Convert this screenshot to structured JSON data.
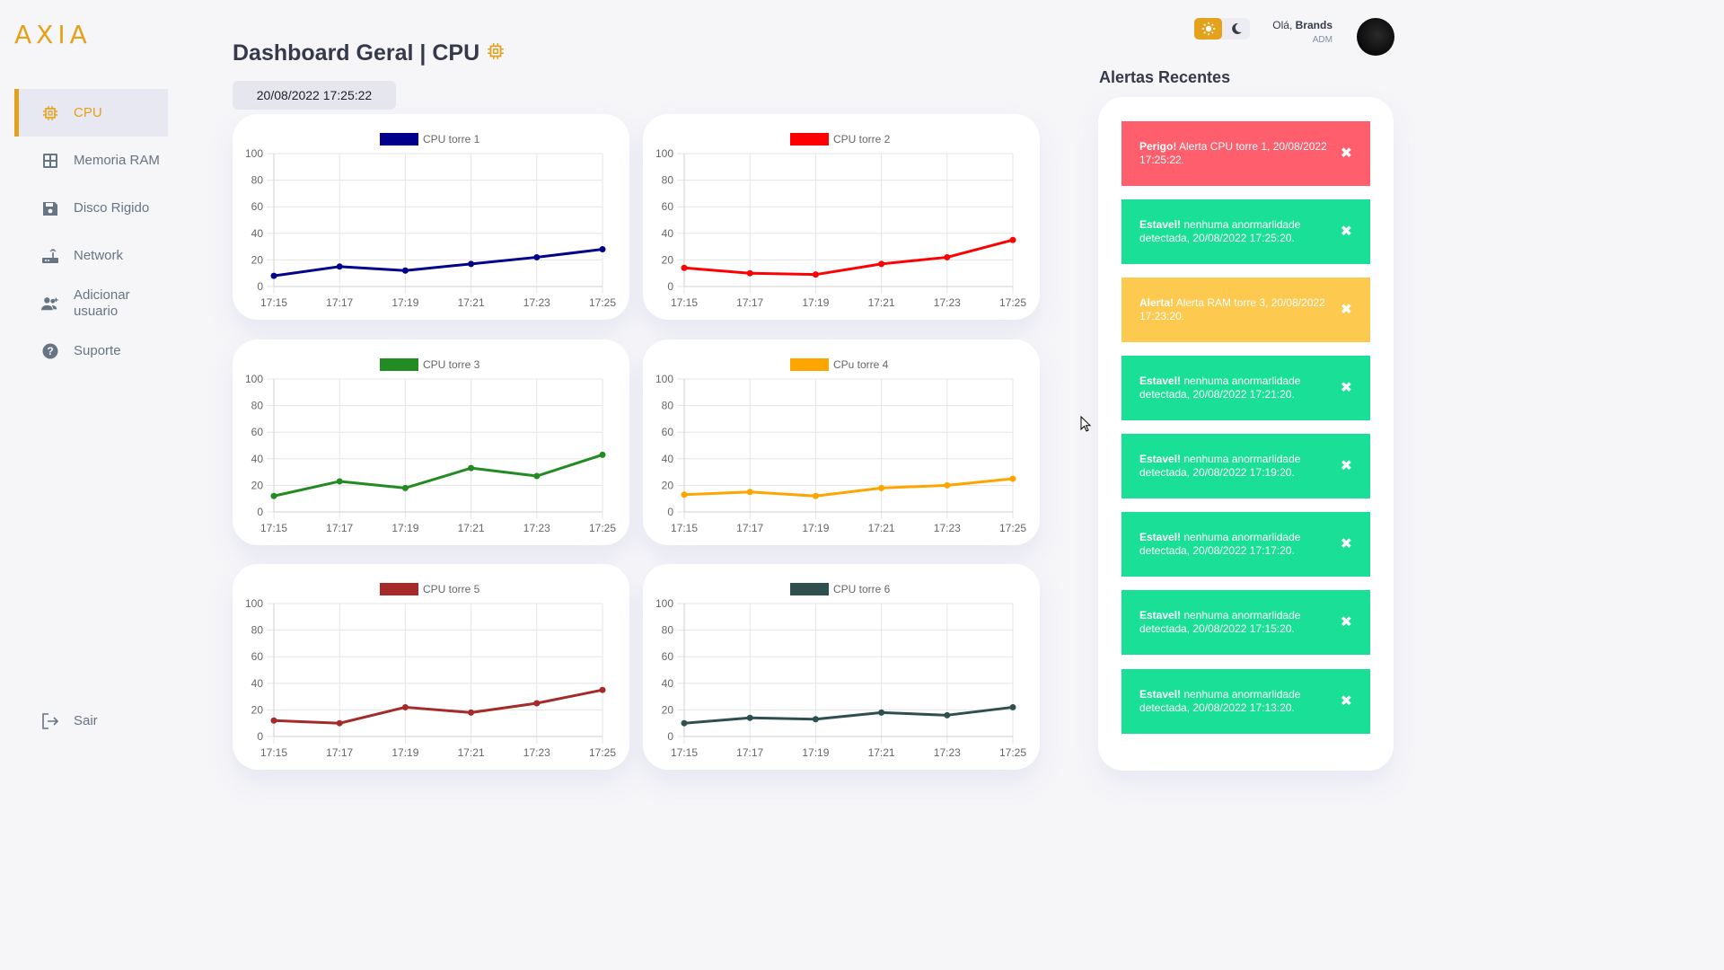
{
  "logo": "AXIA",
  "sidebar": {
    "items": [
      {
        "label": "CPU",
        "icon": "cpu-icon"
      },
      {
        "label": "Memoria RAM",
        "icon": "memory-icon"
      },
      {
        "label": "Disco Rigido",
        "icon": "disk-icon"
      },
      {
        "label": "Network",
        "icon": "router-icon"
      },
      {
        "label": "Adicionar usuario",
        "icon": "add-user-icon"
      },
      {
        "label": "Suporte",
        "icon": "help-icon"
      }
    ],
    "logout": {
      "label": "Sair",
      "icon": "logout-icon"
    }
  },
  "header": {
    "title": "Dashboard Geral | CPU",
    "datetime": "20/08/2022 17:25:22"
  },
  "user": {
    "greeting": "Olá,",
    "name": "Brands",
    "role": "ADM"
  },
  "alerts": {
    "title": "Alertas Recentes",
    "items": [
      {
        "type": "danger",
        "strong": "Perigo!",
        "text": " Alerta CPU torre 1, 20/08/2022 17:25:22."
      },
      {
        "type": "ok",
        "strong": "Estavel!",
        "text": " nenhuma anormarlidade detectada, 20/08/2022 17:25:20."
      },
      {
        "type": "warn",
        "strong": "Alerta!",
        "text": " Alerta RAM torre 3, 20/08/2022 17:23:20."
      },
      {
        "type": "ok",
        "strong": "Estavel!",
        "text": " nenhuma anormarlidade detectada, 20/08/2022 17:21:20."
      },
      {
        "type": "ok",
        "strong": "Estavel!",
        "text": " nenhuma anormarlidade detectada, 20/08/2022 17:19:20."
      },
      {
        "type": "ok",
        "strong": "Estavel!",
        "text": " nenhuma anormarlidade detectada, 20/08/2022 17:17:20."
      },
      {
        "type": "ok",
        "strong": "Estavel!",
        "text": " nenhuma anormarlidade detectada, 20/08/2022 17:15:20."
      },
      {
        "type": "ok",
        "strong": "Estavel!",
        "text": " nenhuma anormarlidade detectada, 20/08/2022 17:13:20."
      }
    ],
    "close_symbol": "✖"
  },
  "colors": {
    "accent": "#e4a11b",
    "danger": "#ff5f6d",
    "success": "#1adf96",
    "warning": "#fdc94f"
  },
  "chart_data": [
    {
      "type": "line",
      "series": [
        {
          "name": "CPU torre 1",
          "color": "#00008b",
          "values": [
            8,
            15,
            12,
            17,
            22,
            28
          ]
        }
      ],
      "categories": [
        "17:15",
        "17:17",
        "17:19",
        "17:21",
        "17:23",
        "17:25"
      ],
      "ylim": [
        0,
        100
      ],
      "yticks": [
        0,
        20,
        40,
        60,
        80,
        100
      ],
      "grid": true,
      "legend": "top"
    },
    {
      "type": "line",
      "series": [
        {
          "name": "CPU torre 2",
          "color": "#ff0000",
          "values": [
            14,
            10,
            9,
            17,
            22,
            35
          ]
        }
      ],
      "categories": [
        "17:15",
        "17:17",
        "17:19",
        "17:21",
        "17:23",
        "17:25"
      ],
      "ylim": [
        0,
        100
      ],
      "yticks": [
        0,
        20,
        40,
        60,
        80,
        100
      ],
      "grid": true,
      "legend": "top"
    },
    {
      "type": "line",
      "series": [
        {
          "name": "CPU torre 3",
          "color": "#228b22",
          "values": [
            12,
            23,
            18,
            33,
            27,
            43
          ]
        }
      ],
      "categories": [
        "17:15",
        "17:17",
        "17:19",
        "17:21",
        "17:23",
        "17:25"
      ],
      "ylim": [
        0,
        100
      ],
      "yticks": [
        0,
        20,
        40,
        60,
        80,
        100
      ],
      "grid": true,
      "legend": "top"
    },
    {
      "type": "line",
      "series": [
        {
          "name": "CPu torre 4",
          "color": "#ffa500",
          "values": [
            13,
            15,
            12,
            18,
            20,
            25
          ]
        }
      ],
      "categories": [
        "17:15",
        "17:17",
        "17:19",
        "17:21",
        "17:23",
        "17:25"
      ],
      "ylim": [
        0,
        100
      ],
      "yticks": [
        0,
        20,
        40,
        60,
        80,
        100
      ],
      "grid": true,
      "legend": "top"
    },
    {
      "type": "line",
      "series": [
        {
          "name": "CPU torre 5",
          "color": "#a52a2a",
          "values": [
            12,
            10,
            22,
            18,
            25,
            35
          ]
        }
      ],
      "categories": [
        "17:15",
        "17:17",
        "17:19",
        "17:21",
        "17:23",
        "17:25"
      ],
      "ylim": [
        0,
        100
      ],
      "yticks": [
        0,
        20,
        40,
        60,
        80,
        100
      ],
      "grid": true,
      "legend": "top"
    },
    {
      "type": "line",
      "series": [
        {
          "name": "CPU torre 6",
          "color": "#2f4f4f",
          "values": [
            10,
            14,
            13,
            18,
            16,
            22
          ]
        }
      ],
      "categories": [
        "17:15",
        "17:17",
        "17:19",
        "17:21",
        "17:23",
        "17:25"
      ],
      "ylim": [
        0,
        100
      ],
      "yticks": [
        0,
        20,
        40,
        60,
        80,
        100
      ],
      "grid": true,
      "legend": "top"
    }
  ]
}
